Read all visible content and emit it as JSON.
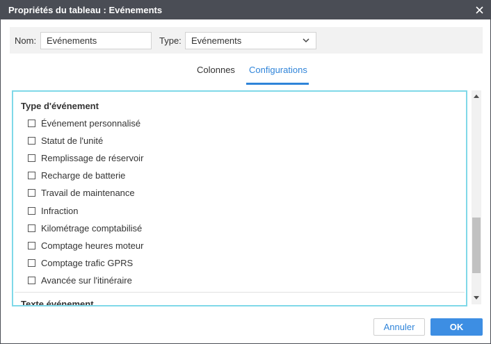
{
  "window": {
    "title": "Propriétés du tableau : Evénements"
  },
  "form": {
    "name_label": "Nom:",
    "name_value": "Evénements",
    "type_label": "Type:",
    "type_selected": "Evénements"
  },
  "tabs": [
    {
      "label": "Colonnes",
      "active": false
    },
    {
      "label": "Configurations",
      "active": true
    }
  ],
  "panel": {
    "section_title": "Type d'événement",
    "items": [
      {
        "label": "Événement personnalisé",
        "checked": false
      },
      {
        "label": "Statut de l'unité",
        "checked": false
      },
      {
        "label": "Remplissage de réservoir",
        "checked": false
      },
      {
        "label": "Recharge de batterie",
        "checked": false
      },
      {
        "label": "Travail de maintenance",
        "checked": false
      },
      {
        "label": "Infraction",
        "checked": false
      },
      {
        "label": "Kilométrage comptabilisé",
        "checked": false
      },
      {
        "label": "Comptage heures moteur",
        "checked": false
      },
      {
        "label": "Comptage trafic GPRS",
        "checked": false
      },
      {
        "label": "Avancée sur l'itinéraire",
        "checked": false
      }
    ],
    "next_section_title": "Texte événement"
  },
  "footer": {
    "cancel_label": "Annuler",
    "ok_label": "OK"
  },
  "colors": {
    "titlebar": "#4a4d55",
    "accent": "#2f84d9",
    "panel_border": "#7fd8e8",
    "ok_button": "#3d8ee3"
  },
  "icons": {
    "close": "close-icon",
    "dropdown": "chevron-down-icon",
    "scroll_up": "arrow-up-icon",
    "scroll_down": "arrow-down-icon"
  }
}
